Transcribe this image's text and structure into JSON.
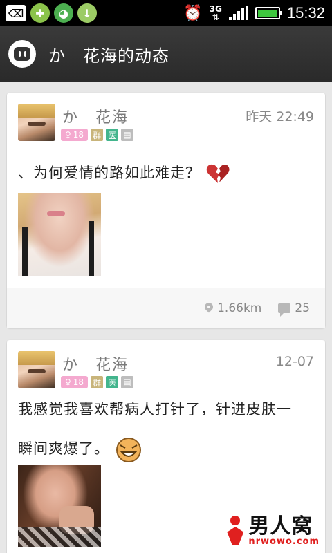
{
  "status_bar": {
    "time": "15:32",
    "network": "3G",
    "battery_level": 0.95
  },
  "header": {
    "title": "か　花海的动态"
  },
  "posts": [
    {
      "username": "か　花海",
      "time": "昨天 22:49",
      "age": "18",
      "tags": [
        "群",
        "医"
      ],
      "text": "、为何爱情的路如此难走？",
      "emoji": "broken-heart",
      "distance": "1.66km",
      "comments": "25"
    },
    {
      "username": "か　花海",
      "time": "12-07",
      "age": "18",
      "tags": [
        "群",
        "医"
      ],
      "text_line1": "我感觉我喜欢帮病人打针了，针进皮肤一",
      "text_line2": "瞬间爽爆了。",
      "emoji": "laughing-face"
    }
  ],
  "watermark": {
    "main": "男人窝",
    "sub": "nrwowo.com"
  }
}
